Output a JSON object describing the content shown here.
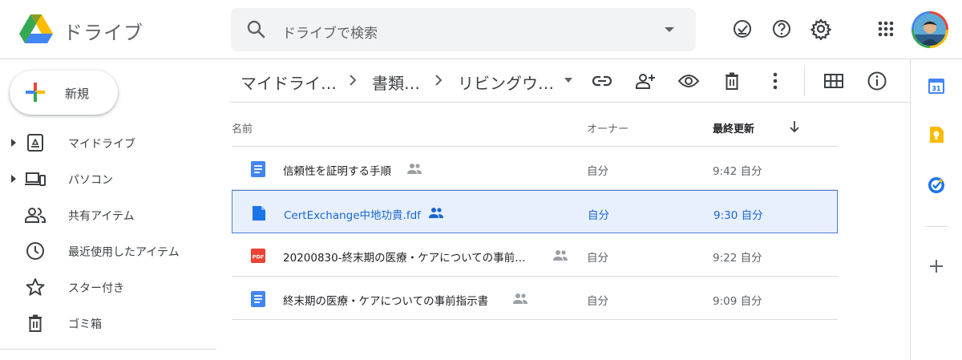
{
  "app": {
    "title": "ドライブ"
  },
  "search": {
    "placeholder": "ドライブで検索"
  },
  "sidebar": {
    "new_label": "新規",
    "items": [
      {
        "label": "マイドライブ",
        "icon": "my-drive-icon"
      },
      {
        "label": "パソコン",
        "icon": "computer-icon"
      },
      {
        "label": "共有アイテム",
        "icon": "people-icon"
      },
      {
        "label": "最近使用したアイテム",
        "icon": "clock-icon"
      },
      {
        "label": "スター付き",
        "icon": "star-icon"
      },
      {
        "label": "ゴミ箱",
        "icon": "trash-icon"
      }
    ]
  },
  "breadcrumb": [
    "マイドライ…",
    "書類…",
    "リビングウ…"
  ],
  "list": {
    "columns": {
      "name": "名前",
      "owner": "オーナー",
      "modified": "最終更新"
    },
    "rows": [
      {
        "name": "信頼性を証明する手順",
        "owner": "自分",
        "modified": "9:42 自分",
        "type": "doc",
        "shared": true,
        "selected": false
      },
      {
        "name": "CertExchange中地功貴.fdf",
        "owner": "自分",
        "modified": "9:30 自分",
        "type": "file",
        "shared": true,
        "selected": true
      },
      {
        "name": "20200830-終末期の医療・ケアについての事前…",
        "owner": "自分",
        "modified": "9:22 自分",
        "type": "pdf",
        "shared": true,
        "selected": false
      },
      {
        "name": "終末期の医療・ケアについての事前指示書",
        "owner": "自分",
        "modified": "9:09 自分",
        "type": "doc",
        "shared": true,
        "selected": false
      }
    ]
  },
  "side_panel": {
    "calendar_day": "31",
    "icons": [
      "calendar-icon",
      "keep-icon",
      "tasks-icon",
      "add-icon"
    ]
  },
  "colors": {
    "accent": "#1a73e8",
    "selected_bg": "#e8f0fe",
    "selected_text": "#1967d2",
    "pdf_red": "#ea4335",
    "doc_blue": "#4285f4"
  }
}
